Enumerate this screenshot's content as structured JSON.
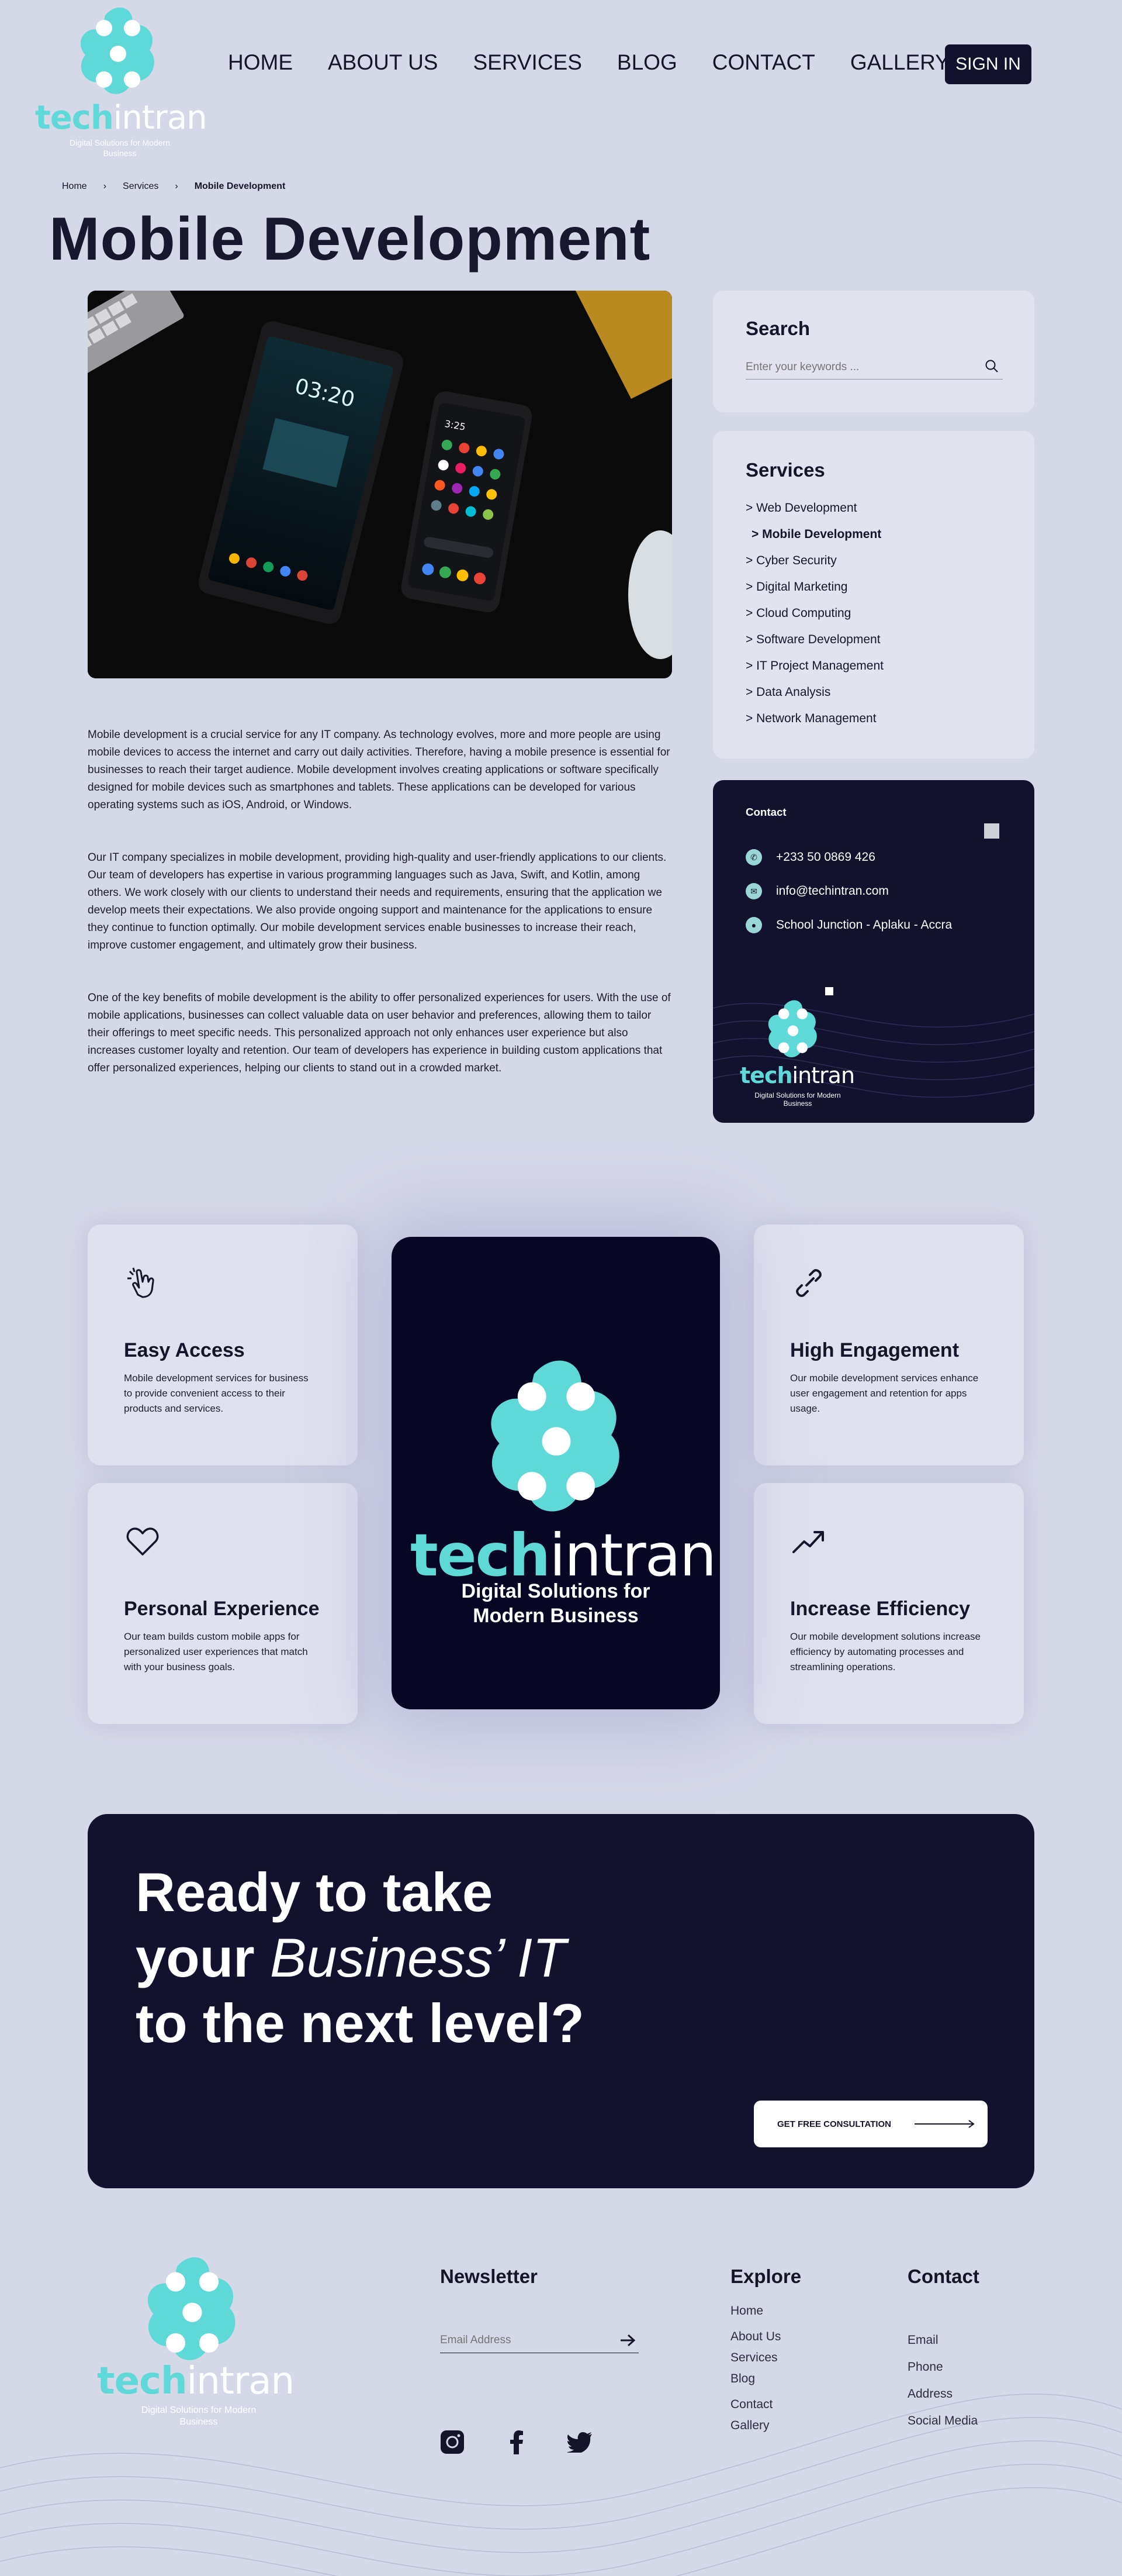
{
  "header": {
    "logo_word_a": "tech",
    "logo_word_b": "intran",
    "logo_tagline": "Digital Solutions for Modern Business",
    "nav": [
      "HOME",
      "ABOUT US",
      "SERVICES",
      "BLOG",
      "CONTACT",
      "GALLERY"
    ],
    "sign_in": "SIGN IN"
  },
  "breadcrumb": [
    "Home",
    "Services",
    "Mobile Development"
  ],
  "page_title": "Mobile Development",
  "paragraphs": [
    "Mobile development is a crucial service for any IT company. As technology evolves, more and more people are using mobile devices to access the internet and carry out daily activities. Therefore, having a mobile presence is essential for businesses to reach their target audience. Mobile development involves creating applications or software specifically designed for mobile devices such as smartphones and tablets. These applications can be developed for various operating systems such as iOS, Android, or Windows.",
    "Our IT company specializes in mobile development, providing high-quality and user-friendly applications to our clients. Our team of developers has expertise in various programming languages such as Java, Swift, and Kotlin, among others. We work closely with our clients to understand their needs and requirements, ensuring that the application we develop meets their expectations. We also provide ongoing support and maintenance for the applications to ensure they continue to function optimally. Our mobile development services enable businesses to increase their reach, improve customer engagement, and ultimately grow their business.",
    "One of the key benefits of mobile development is the ability to offer personalized experiences for users. With the use of mobile applications, businesses can collect valuable data on user behavior and preferences, allowing them to tailor their offerings to meet specific needs. This personalized approach not only enhances user experience but also increases customer loyalty and retention. Our team of developers has experience in building custom applications that offer personalized experiences, helping our clients to stand out in a crowded market."
  ],
  "search": {
    "title": "Search",
    "placeholder": "Enter your keywords ..."
  },
  "services": {
    "title": "Services",
    "items": [
      "> Web Development",
      "> Mobile Development",
      "> Cyber Security",
      "> Digital Marketing",
      "> Cloud Computing",
      "> Software Development",
      "> IT Project Management",
      "> Data Analysis",
      "> Network Management"
    ]
  },
  "contact": {
    "title": "Contact",
    "phone": "+233 50 0869 426",
    "email": "info@techintran.com",
    "address": "School Junction - Aplaku - Accra"
  },
  "features": [
    {
      "title": "Easy Access",
      "text": "Mobile development services for business to provide convenient access to their products and services.",
      "icon": "hand-pointer-icon"
    },
    {
      "title": "High Engagement",
      "text": "Our mobile development services enhance user engagement and retention for apps usage.",
      "icon": "link-icon"
    },
    {
      "title": "Personal Experience",
      "text": "Our team builds custom mobile apps for personalized user experiences that match with your business goals.",
      "icon": "heart-icon"
    },
    {
      "title": "Increase Efficiency",
      "text": "Our mobile development solutions increase efficiency by automating processes and streamlining operations.",
      "icon": "trending-up-icon"
    }
  ],
  "center_logo": {
    "tagline_1": "Digital Solutions for",
    "tagline_2": "Modern Business"
  },
  "cta": {
    "line1": "Ready to take",
    "line2a": "your ",
    "line2b": "Business’ IT",
    "line3": "to the next level?",
    "button": "GET FREE CONSULTATION"
  },
  "footer": {
    "newsletter_title": "Newsletter",
    "email_placeholder": "Email Address",
    "explore_title": "Explore",
    "explore": [
      "Home",
      "About Us",
      "Services",
      "Blog",
      "Contact",
      "Gallery"
    ],
    "contact_title": "Contact",
    "contact": [
      "Email",
      "Phone",
      "Address",
      "Social Media"
    ]
  },
  "colors": {
    "accent": "#5fd8d8",
    "dark": "#12122e",
    "bg": "#d5d8e7"
  }
}
